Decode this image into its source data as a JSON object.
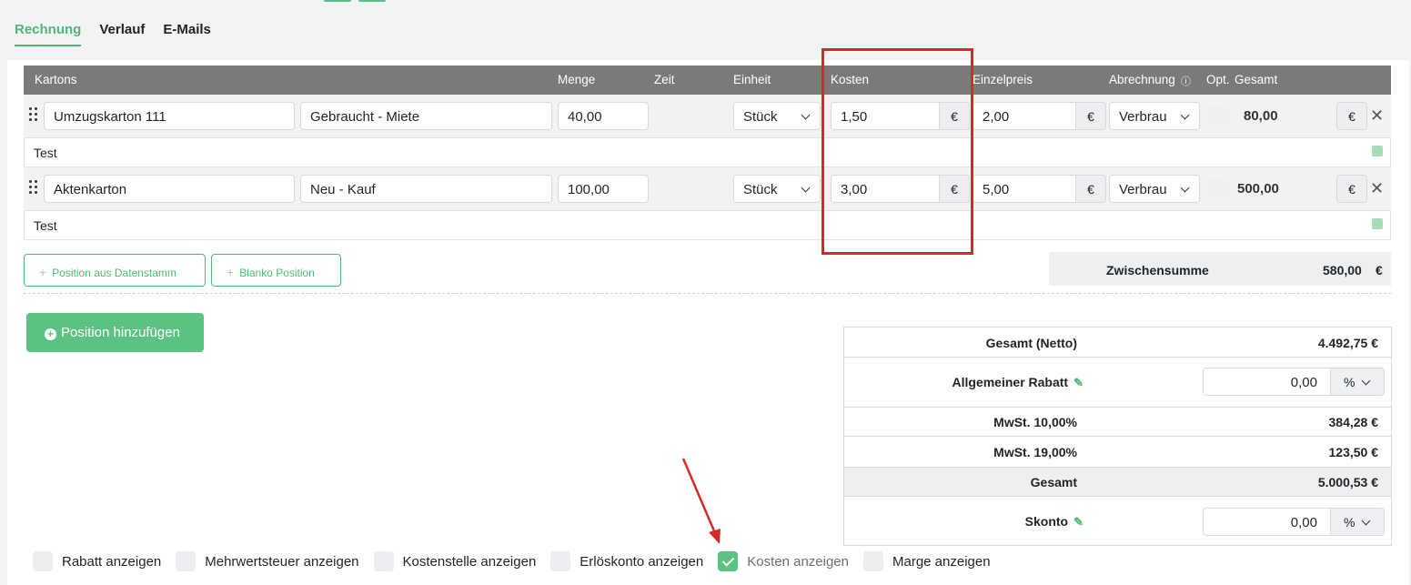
{
  "tabs": [
    {
      "label": "Rechnung",
      "active": true
    },
    {
      "label": "Verlauf",
      "active": false
    },
    {
      "label": "E-Mails",
      "active": false
    }
  ],
  "table": {
    "headers": {
      "kartons": "Kartons",
      "menge": "Menge",
      "zeit": "Zeit",
      "einheit": "Einheit",
      "kosten": "Kosten",
      "einzelpreis": "Einzelpreis",
      "abrechnung": "Abrechnung",
      "opt": "Opt.",
      "gesamt": "Gesamt"
    },
    "rows": [
      {
        "name": "Umzugskarton 111",
        "type": "Gebraucht - Miete",
        "menge": "40,00",
        "einheit": "Stück",
        "kosten": "1,50",
        "einzelpreis": "2,00",
        "abrechnung": "Verbrau",
        "gesamt": "80,00",
        "currency": "€",
        "note": "Test"
      },
      {
        "name": "Aktenkarton",
        "type": "Neu - Kauf",
        "menge": "100,00",
        "einheit": "Stück",
        "kosten": "3,00",
        "einzelpreis": "5,00",
        "abrechnung": "Verbrau",
        "gesamt": "500,00",
        "currency": "€",
        "note": "Test"
      }
    ]
  },
  "buttons": {
    "from_master": "Position aus Datenstamm",
    "blank": "Blanko Position",
    "add": "Position hinzufügen"
  },
  "subtotal": {
    "label": "Zwischensumme",
    "value": "580,00",
    "currency": "€"
  },
  "summary": {
    "net_label": "Gesamt (Netto)",
    "net_value": "4.492,75 €",
    "discount_label": "Allgemeiner Rabatt",
    "discount_value": "0,00",
    "discount_unit": "%",
    "vat10_label": "MwSt. 10,00%",
    "vat10_value": "384,28 €",
    "vat19_label": "MwSt. 19,00%",
    "vat19_value": "123,50 €",
    "total_label": "Gesamt",
    "total_value": "5.000,53 €",
    "skonto_label": "Skonto",
    "skonto_value": "0,00",
    "skonto_unit": "%"
  },
  "options": [
    {
      "label": "Rabatt anzeigen",
      "checked": false
    },
    {
      "label": "Mehrwertsteuer anzeigen",
      "checked": false
    },
    {
      "label": "Kostenstelle anzeigen",
      "checked": false
    },
    {
      "label": "Erlöskonto anzeigen",
      "checked": false
    },
    {
      "label": "Kosten anzeigen",
      "checked": true
    },
    {
      "label": "Marge anzeigen",
      "checked": false
    }
  ],
  "colors": {
    "accent": "#4fb874",
    "annotation": "#d42a2a",
    "header": "#7a7a7a"
  }
}
